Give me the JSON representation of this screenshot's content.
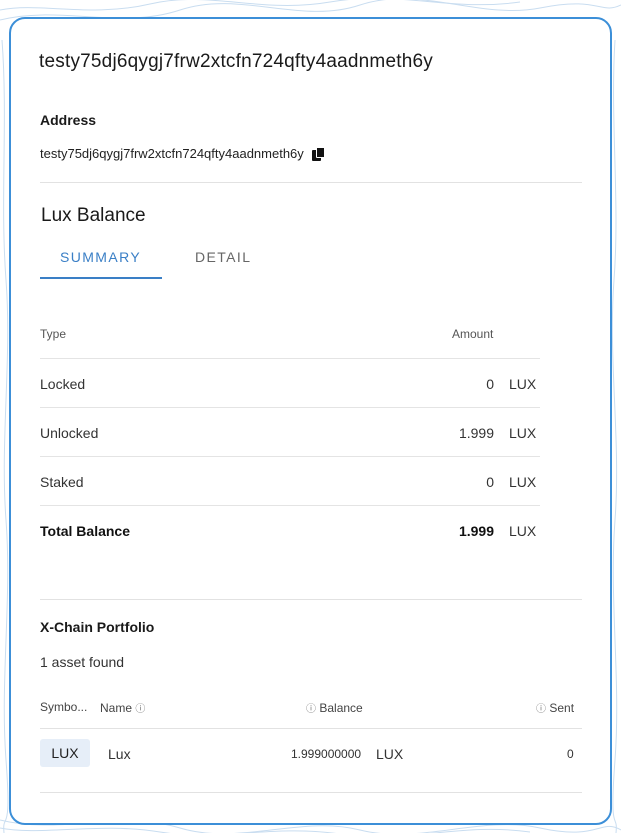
{
  "address_title": {
    "prefix": "test",
    "rest": "y75dj6qygj7frw2xtcfn724qfty4aadnmeth6y"
  },
  "address_section": {
    "label": "Address",
    "prefix": "test",
    "rest": "y75dj6qygj7frw2xtcfn724qfty4aadnmeth6y"
  },
  "balance": {
    "title": "Lux Balance",
    "tabs": [
      {
        "label": "SUMMARY",
        "active": true
      },
      {
        "label": "DETAIL",
        "active": false
      }
    ],
    "columns": {
      "type": "Type",
      "amount": "Amount"
    },
    "rows": [
      {
        "type": "Locked",
        "amount": "0",
        "unit": "LUX"
      },
      {
        "type": "Unlocked",
        "amount": "1.999",
        "unit": "LUX"
      },
      {
        "type": "Staked",
        "amount": "0",
        "unit": "LUX"
      },
      {
        "type": "Total Balance",
        "amount": "1.999",
        "unit": "LUX"
      }
    ]
  },
  "portfolio": {
    "title": "X-Chain Portfolio",
    "count": "1 asset found",
    "columns": {
      "symbol": "Symbo...",
      "name": "Name",
      "balance": "Balance",
      "sent": "Sent"
    },
    "info_glyph": "ⓘ",
    "rows": [
      {
        "symbol": "LUX",
        "name": "Lux",
        "balance": "1.999000000",
        "unit": "LUX",
        "sent": "0"
      }
    ]
  },
  "colors": {
    "accent": "#3a7fc6",
    "border": "#3c8fd8",
    "chip": "#e6eef8"
  },
  "icons": {
    "copy": "copy-icon",
    "info": "info-icon"
  }
}
